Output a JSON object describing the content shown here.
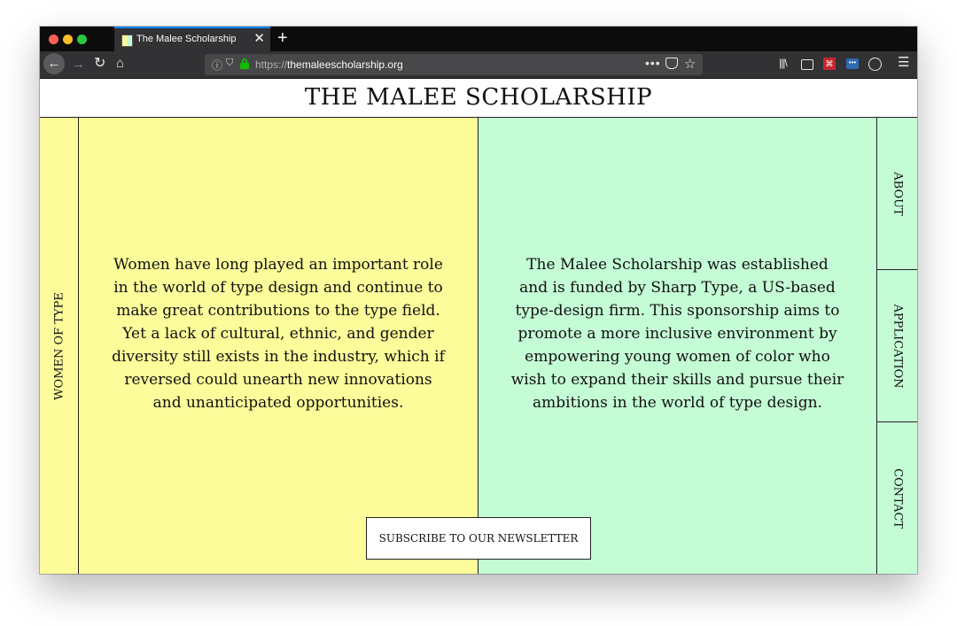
{
  "browser": {
    "tab_title": "The Malee Scholarship",
    "tab_close": "✕",
    "new_tab": "+",
    "url_protocol": "https://",
    "url_host": "themaleescholarship.org",
    "url_more": "•••",
    "icons": {
      "back": "back-arrow-icon",
      "forward": "forward-arrow-icon",
      "reload": "reload-icon",
      "home": "home-icon",
      "info": "info-icon",
      "shield": "tracking-shield-icon",
      "lock": "lock-icon",
      "pocket": "pocket-icon",
      "star": "bookmark-star-icon",
      "library": "library-icon",
      "sidebar": "sidebar-icon",
      "pdf": "pdf-extension-icon",
      "extension": "extension-icon",
      "account": "account-icon",
      "menu": "hamburger-menu-icon"
    }
  },
  "site": {
    "title": "THE MALEE SCHOLARSHIP",
    "left_label": "WOMEN OF TYPE",
    "left_text": "Women have long played an important role in the world of type design and continue to make great contributions to the type field. Yet a lack of cultural, ethnic, and gender diversity still exists in the industry, which if reversed could unearth new innovations and unanticipated opportunities.",
    "right_text": "The Malee Scholarship was established and is funded by Sharp Type, a US-based type-design firm. This sponsorship aims to promote a more inclusive environment by empowering young women of color who wish to expand their skills and pursue their ambitions in the world of type design.",
    "nav": {
      "about": "ABOUT",
      "application": "APPLICATION",
      "contact": "CONTACT"
    },
    "newsletter_button": "SUBSCRIBE TO OUR NEWSLETTER"
  },
  "colors": {
    "yellow_panel": "#fdfc9a",
    "green_panel": "#c4fcd5",
    "lock_green": "#12bc00",
    "tab_accent": "#0a84ff"
  }
}
